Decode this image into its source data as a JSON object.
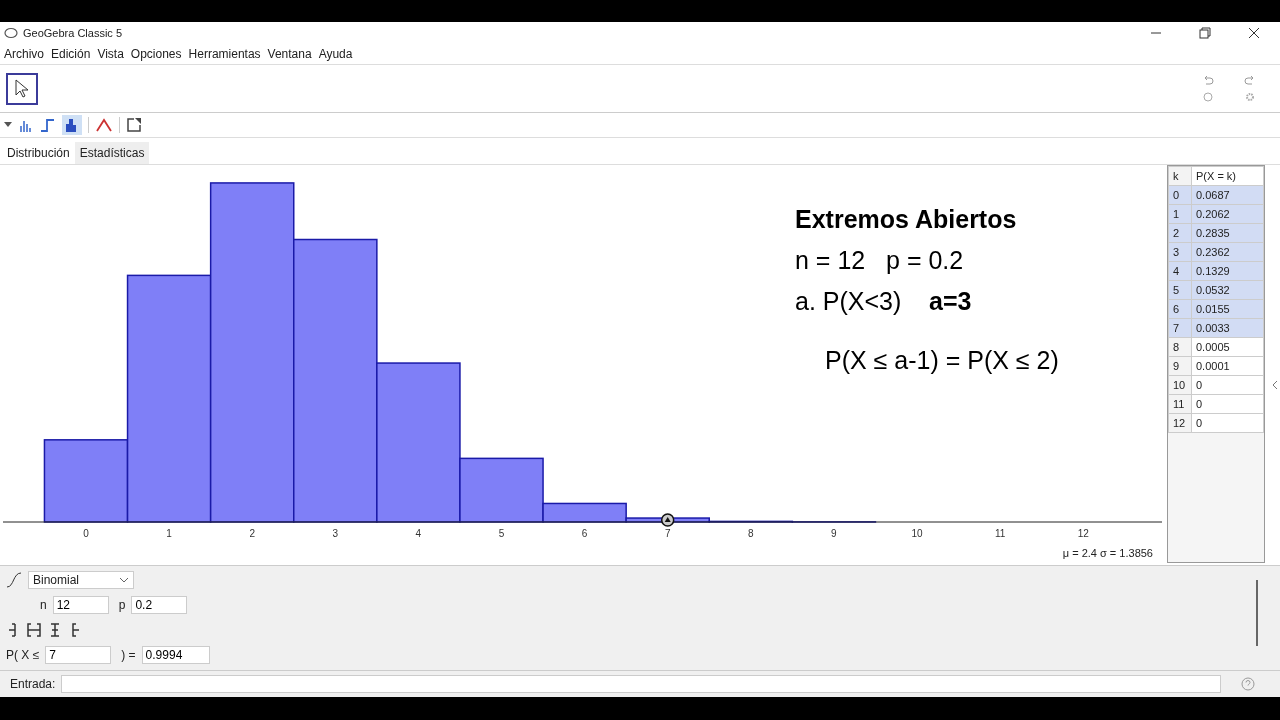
{
  "window": {
    "title": "GeoGebra Classic 5"
  },
  "menu": [
    "Archivo",
    "Edición",
    "Vista",
    "Opciones",
    "Herramientas",
    "Ventana",
    "Ayuda"
  ],
  "tabs": [
    {
      "label": "Distribución",
      "selected": true
    },
    {
      "label": "Estadísticas",
      "selected": false
    }
  ],
  "chart": {
    "kind": "histogram",
    "tick_labels": [
      "0",
      "1",
      "2",
      "3",
      "4",
      "5",
      "6",
      "7",
      "8",
      "9",
      "10",
      "11",
      "12"
    ],
    "stats": "μ = 2.4   σ = 1.3856"
  },
  "notes": [
    {
      "text": "Extremos Abiertos",
      "kind": "title"
    },
    {
      "text": "n = 12   p = 0.2",
      "kind": "line"
    },
    {
      "text": "a. P(X<3)    **a=3**",
      "kind": "line"
    },
    {
      "text": "P(X ≤ a-1) = P(X ≤ 2)",
      "kind": "indent"
    }
  ],
  "table": {
    "columns": [
      "k",
      "P(X = k)"
    ],
    "rows": [
      {
        "k": "0",
        "p": "0.0687",
        "selected": true
      },
      {
        "k": "1",
        "p": "0.2062",
        "selected": true
      },
      {
        "k": "2",
        "p": "0.2835",
        "selected": true
      },
      {
        "k": "3",
        "p": "0.2362",
        "selected": true
      },
      {
        "k": "4",
        "p": "0.1329",
        "selected": true
      },
      {
        "k": "5",
        "p": "0.0532",
        "selected": true
      },
      {
        "k": "6",
        "p": "0.0155",
        "selected": true
      },
      {
        "k": "7",
        "p": "0.0033",
        "selected": true
      },
      {
        "k": "8",
        "p": "0.0005",
        "selected": false
      },
      {
        "k": "9",
        "p": "0.0001",
        "selected": false
      },
      {
        "k": "10",
        "p": "0",
        "selected": false
      },
      {
        "k": "11",
        "p": "0",
        "selected": false
      },
      {
        "k": "12",
        "p": "0",
        "selected": false
      }
    ]
  },
  "distribution": {
    "type": "Binomial",
    "params": [
      {
        "label": "n",
        "value": "12"
      },
      {
        "label": "p",
        "value": "0.2"
      }
    ],
    "probability": {
      "prefix": "P( X ≤",
      "value": "7",
      "suffix": ") =",
      "result": "0.9994"
    }
  },
  "input_bar": {
    "label": "Entrada:"
  }
}
